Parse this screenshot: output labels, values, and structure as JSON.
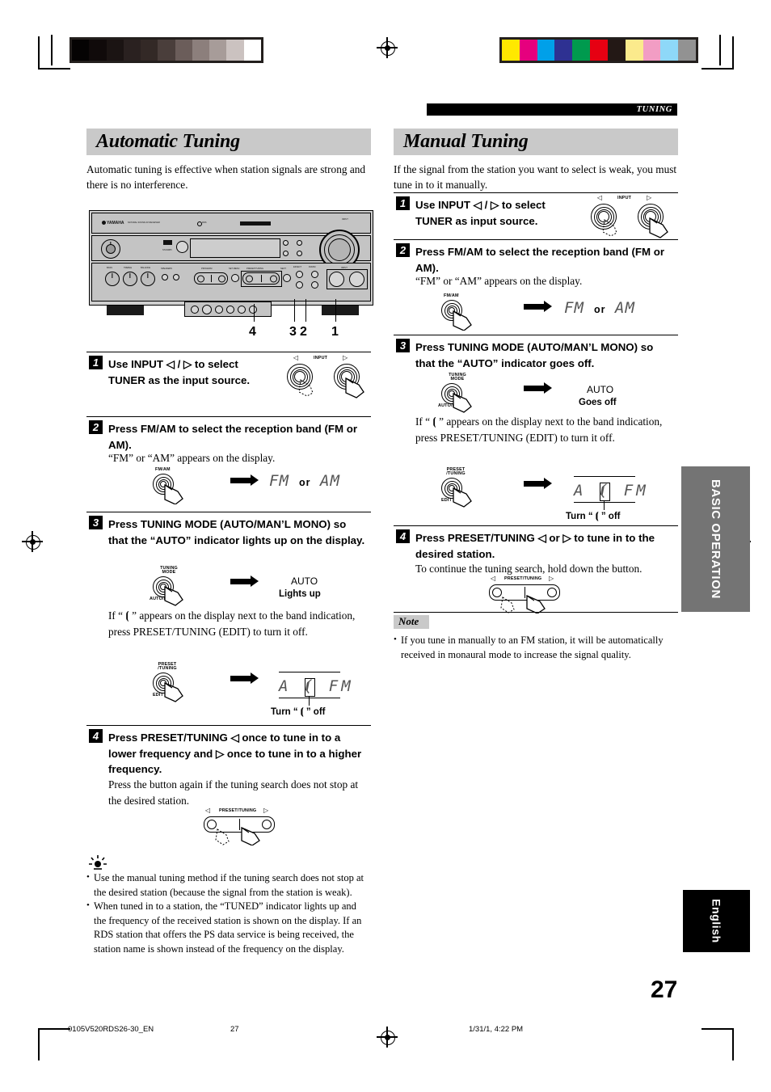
{
  "page": {
    "header_tag": "TUNING",
    "page_number": "27",
    "side_tab_primary": "BASIC OPERATION",
    "side_tab_language": "English",
    "footer_doc_id": "0105V520RDS26-30_EN",
    "footer_page": "27",
    "footer_timestamp": "1/31/1, 4:22 PM"
  },
  "colorbars": {
    "grayscale": [
      "#050303",
      "#100a0a",
      "#1b1413",
      "#2a2120",
      "#332926",
      "#4a3e3b",
      "#6b5d5a",
      "#8c7f7c",
      "#a79c99",
      "#cbc2c0",
      "#ffffff"
    ],
    "process": [
      "#ffe800",
      "#e6007e",
      "#00a0e9",
      "#2e3192",
      "#009a4e",
      "#e60012",
      "#231815",
      "#fbea8c",
      "#f29dc4",
      "#8ed8f8",
      "#929292"
    ]
  },
  "left_column": {
    "title": "Automatic Tuning",
    "intro": "Automatic tuning is effective when station signals are strong and there is no interference.",
    "diagram": {
      "brand": "YAMAHA",
      "model_line": "NATURAL SOUND  AV RECEIVER",
      "callouts": [
        "4",
        "3",
        "2",
        "1"
      ],
      "panel_labels": [
        "BASS",
        "TREBLE",
        "BALANCE",
        "SPEAKERS",
        "PROGRAM",
        "SET MENU",
        "PRESET/TUNING",
        "NEXT",
        "EFFECT",
        "FM/AM",
        "TUNING MODE",
        "INPUT"
      ]
    },
    "steps": [
      {
        "num": "1",
        "title": "Use INPUT ◁ / ▷ to select TUNER as the input source.",
        "body": "",
        "art_label": "INPUT"
      },
      {
        "num": "2",
        "title": "Press FM/AM to select the reception band (FM or AM).",
        "body": "“FM” or “AM” appears on the display.",
        "art_label": "FM/AM",
        "lcd_left": "FM",
        "lcd_or": "or",
        "lcd_right": "AM"
      },
      {
        "num": "3",
        "title": "Press TUNING MODE (AUTO/MAN’L MONO) so that the “AUTO” indicator lights up on the display.",
        "body": "If “ ⦗ ” appears on the display next to the band indication, press PRESET/TUNING (EDIT) to turn it off.",
        "art_label_top": "TUNING MODE",
        "art_label_bottom": "AUTO/MAN’L",
        "result_indicator": "AUTO",
        "result_state": "Lights up",
        "art2_label_top": "PRESET /TUNING",
        "art2_label_bottom": "EDIT",
        "lcd_display": "A ⦗ FM",
        "lcd_caption": "Turn “ ⦗ ” off"
      },
      {
        "num": "4",
        "title": "Press PRESET/TUNING ◁ once to tune in to a lower frequency and ▷ once to tune in to a higher frequency.",
        "body": "Press the button again if the tuning search does not stop at the desired station.",
        "art_label": "PRESET/TUNING"
      }
    ],
    "tips": [
      "Use the manual tuning method if the tuning search does not stop at the desired station (because the signal from the station is weak).",
      "When tuned in to a station, the “TUNED” indicator lights up and the frequency of the received station is shown on the display. If an RDS station that offers the PS data service is being received, the station name is shown instead of the frequency on the display."
    ]
  },
  "right_column": {
    "title": "Manual Tuning",
    "intro": "If the signal from the station you want to select is weak, you must tune in to it manually.",
    "steps": [
      {
        "num": "1",
        "title": "Use INPUT ◁ / ▷ to select TUNER as input source.",
        "body": "",
        "art_label": "INPUT"
      },
      {
        "num": "2",
        "title": "Press FM/AM to select the reception band (FM or AM).",
        "body": "“FM” or “AM” appears on the display.",
        "art_label": "FM/AM",
        "lcd_left": "FM",
        "lcd_or": "or",
        "lcd_right": "AM"
      },
      {
        "num": "3",
        "title": "Press TUNING MODE (AUTO/MAN’L MONO) so that the “AUTO” indicator goes off.",
        "body": "If “ ⦗ ” appears on the display next to the band indication, press PRESET/TUNING (EDIT) to turn it off.",
        "art_label_top": "TUNING MODE",
        "art_label_bottom": "AUTO/MAN’L",
        "result_indicator": "AUTO",
        "result_state": "Goes off",
        "art2_label_top": "PRESET /TUNING",
        "art2_label_bottom": "EDIT",
        "lcd_display": "A ⦗ FM",
        "lcd_caption": "Turn “ ⦗ ” off"
      },
      {
        "num": "4",
        "title": "Press PRESET/TUNING ◁ or ▷ to tune in to the desired station.",
        "body": "To continue the tuning search, hold down the button.",
        "art_label": "PRESET/TUNING"
      }
    ],
    "note_label": "Note",
    "notes": [
      "If you tune in manually to an FM station, it will be automatically received in monaural mode to increase the signal quality."
    ]
  }
}
